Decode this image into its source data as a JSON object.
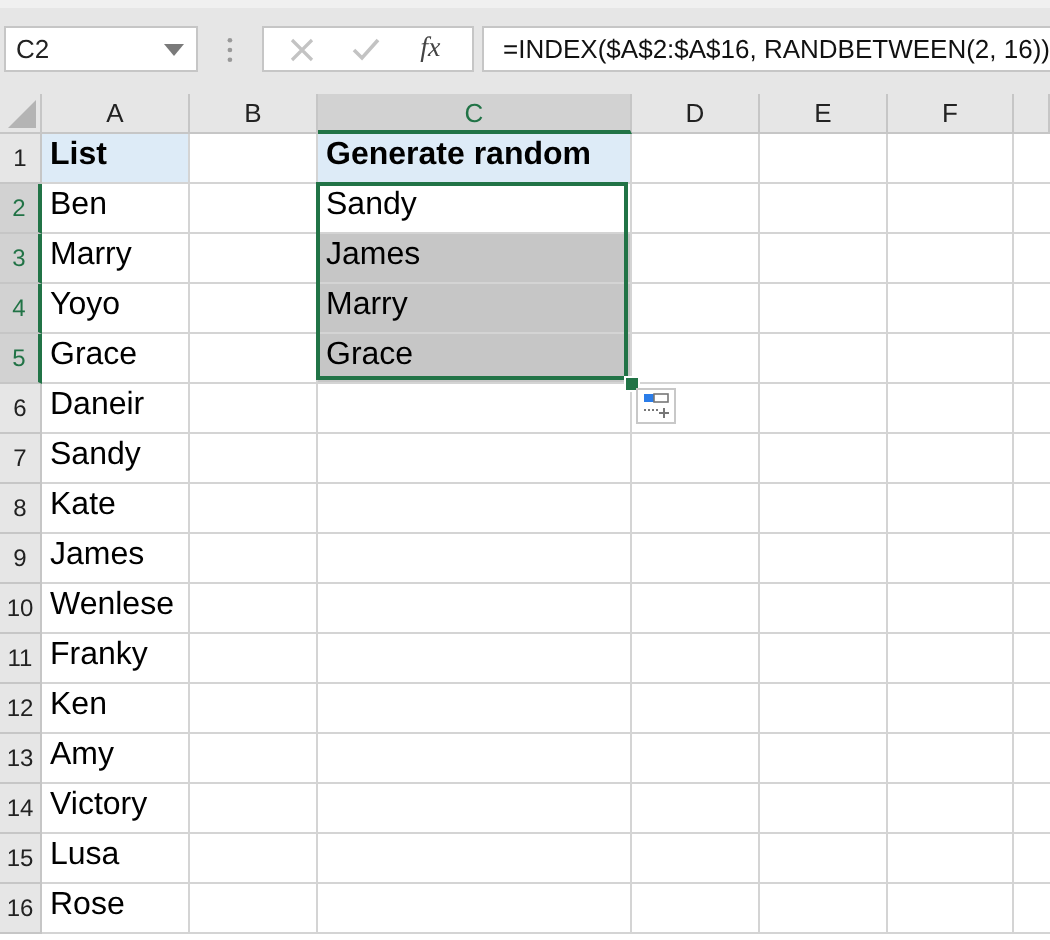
{
  "name_box": "C2",
  "formula_bar": {
    "fx": "fx",
    "formula": "=INDEX($A$2:$A$16, RANDBETWEEN(2, 16))"
  },
  "columns": [
    {
      "label": "A",
      "selected": false
    },
    {
      "label": "B",
      "selected": false
    },
    {
      "label": "C",
      "selected": true
    },
    {
      "label": "D",
      "selected": false
    },
    {
      "label": "E",
      "selected": false
    },
    {
      "label": "F",
      "selected": false
    }
  ],
  "rows": [
    {
      "number": "1",
      "selected": false,
      "column_a": {
        "text": "List",
        "bold": true,
        "shaded": true
      },
      "column_c": {
        "text": "Generate random",
        "bold": true,
        "shaded": true,
        "selected": false,
        "active": false
      }
    },
    {
      "number": "2",
      "selected": true,
      "column_a": {
        "text": "Ben",
        "bold": false,
        "shaded": false
      },
      "column_c": {
        "text": "Sandy",
        "bold": false,
        "shaded": false,
        "selected": true,
        "active": true
      }
    },
    {
      "number": "3",
      "selected": true,
      "column_a": {
        "text": "Marry",
        "bold": false,
        "shaded": false
      },
      "column_c": {
        "text": "James",
        "bold": false,
        "shaded": false,
        "selected": true,
        "active": false
      }
    },
    {
      "number": "4",
      "selected": true,
      "column_a": {
        "text": "Yoyo",
        "bold": false,
        "shaded": false
      },
      "column_c": {
        "text": "Marry",
        "bold": false,
        "shaded": false,
        "selected": true,
        "active": false
      }
    },
    {
      "number": "5",
      "selected": true,
      "column_a": {
        "text": "Grace",
        "bold": false,
        "shaded": false
      },
      "column_c": {
        "text": "Grace",
        "bold": false,
        "shaded": false,
        "selected": true,
        "active": false
      }
    },
    {
      "number": "6",
      "selected": false,
      "column_a": {
        "text": "Daneir",
        "bold": false,
        "shaded": false
      }
    },
    {
      "number": "7",
      "selected": false,
      "column_a": {
        "text": "Sandy",
        "bold": false,
        "shaded": false
      }
    },
    {
      "number": "8",
      "selected": false,
      "column_a": {
        "text": "Kate",
        "bold": false,
        "shaded": false
      }
    },
    {
      "number": "9",
      "selected": false,
      "column_a": {
        "text": "James",
        "bold": false,
        "shaded": false
      }
    },
    {
      "number": "10",
      "selected": false,
      "column_a": {
        "text": "Wenlese",
        "bold": false,
        "shaded": false
      }
    },
    {
      "number": "11",
      "selected": false,
      "column_a": {
        "text": "Franky",
        "bold": false,
        "shaded": false
      }
    },
    {
      "number": "12",
      "selected": false,
      "column_a": {
        "text": "Ken",
        "bold": false,
        "shaded": false
      }
    },
    {
      "number": "13",
      "selected": false,
      "column_a": {
        "text": "Amy",
        "bold": false,
        "shaded": false
      }
    },
    {
      "number": "14",
      "selected": false,
      "column_a": {
        "text": "Victory",
        "bold": false,
        "shaded": false
      }
    },
    {
      "number": "15",
      "selected": false,
      "column_a": {
        "text": "Lusa",
        "bold": false,
        "shaded": false
      }
    },
    {
      "number": "16",
      "selected": false,
      "column_a": {
        "text": "Rose",
        "bold": false,
        "shaded": false
      }
    }
  ]
}
